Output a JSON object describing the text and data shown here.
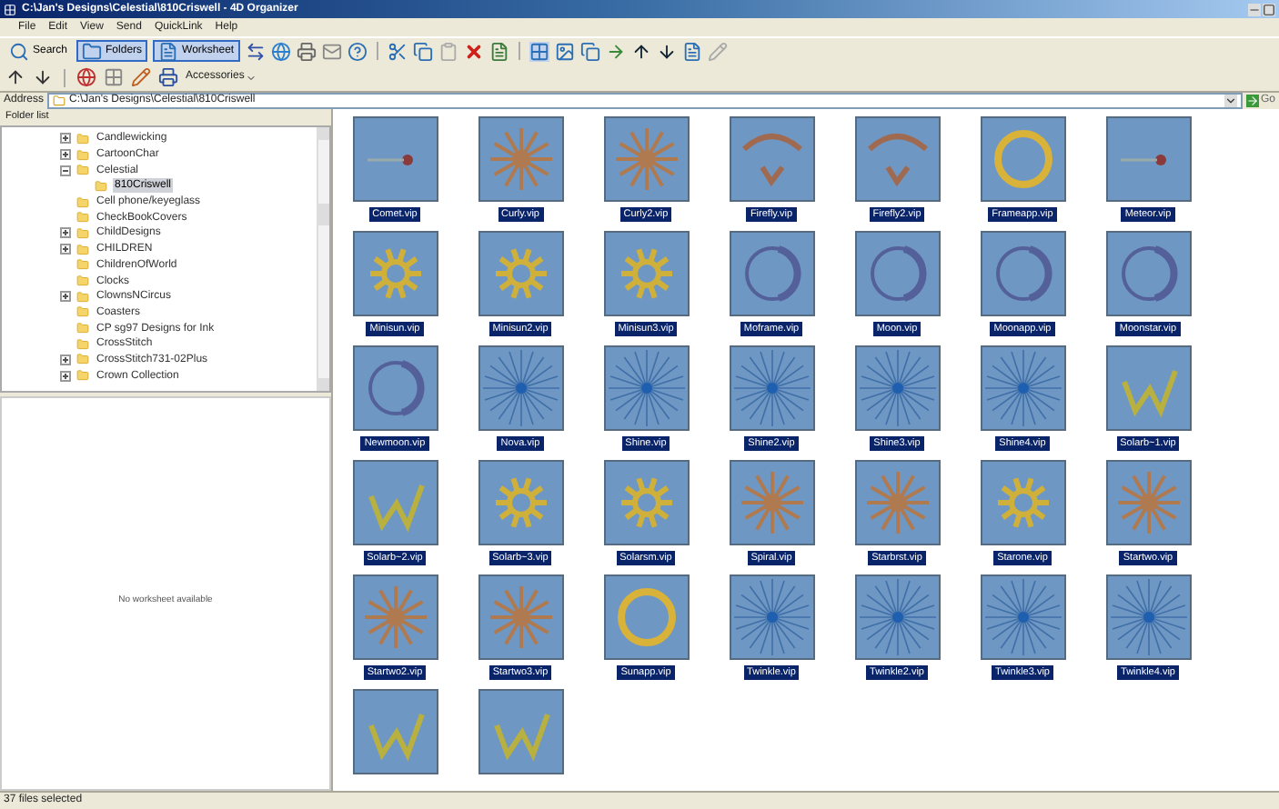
{
  "window": {
    "title": "C:\\Jan's Designs\\Celestial\\810Criswell - 4D Organizer"
  },
  "menu": [
    "File",
    "Edit",
    "View",
    "Send",
    "QuickLink",
    "Help"
  ],
  "toolbar": [
    {
      "label": "Search",
      "selected": false
    },
    {
      "label": "Folders",
      "selected": true
    },
    {
      "label": "Worksheet",
      "selected": true
    }
  ],
  "toolbar2": {
    "accessories": "Accessories"
  },
  "address": {
    "label": "Address",
    "value": "C:\\Jan's Designs\\Celestial\\810Criswell",
    "go": "Go"
  },
  "folder_list": {
    "title": "Folder list",
    "items": [
      {
        "label": "Candlewicking",
        "kind": "collapsed",
        "selected": false
      },
      {
        "label": "CartoonChar",
        "kind": "collapsed",
        "selected": false
      },
      {
        "label": "Celestial",
        "kind": "expanded",
        "selected": false,
        "children": [
          {
            "label": "810Criswell",
            "selected": true
          }
        ]
      },
      {
        "label": "Cell phone/keyeglass",
        "kind": "leaf",
        "selected": false
      },
      {
        "label": "CheckBookCovers",
        "kind": "leaf",
        "selected": false
      },
      {
        "label": "ChildDesigns",
        "kind": "collapsed",
        "selected": false
      },
      {
        "label": "CHILDREN",
        "kind": "collapsed",
        "selected": false
      },
      {
        "label": "ChildrenOfWorld",
        "kind": "leaf",
        "selected": false
      },
      {
        "label": "Clocks",
        "kind": "leaf",
        "selected": false
      },
      {
        "label": "ClownsNCircus",
        "kind": "collapsed",
        "selected": false
      },
      {
        "label": "Coasters",
        "kind": "leaf",
        "selected": false
      },
      {
        "label": "CP sg97 Designs for Ink",
        "kind": "leaf",
        "selected": false
      },
      {
        "label": "CrossStitch",
        "kind": "leaf",
        "selected": false
      },
      {
        "label": "CrossStitch731-02Plus",
        "kind": "collapsed",
        "selected": false
      },
      {
        "label": "Crown Collection",
        "kind": "collapsed",
        "selected": false
      }
    ]
  },
  "preview": {
    "message": "No worksheet available"
  },
  "files": [
    {
      "name": "Comet.vip",
      "kind": "comet",
      "selected": true
    },
    {
      "name": "Curly.vip",
      "kind": "star",
      "selected": true
    },
    {
      "name": "Curly2.vip",
      "kind": "star",
      "selected": true
    },
    {
      "name": "Firefly.vip",
      "kind": "ornament",
      "selected": true
    },
    {
      "name": "Firefly2.vip",
      "kind": "ornament",
      "selected": true
    },
    {
      "name": "Frameapp.vip",
      "kind": "ring",
      "selected": true
    },
    {
      "name": "Meteor.vip",
      "kind": "comet",
      "selected": true
    },
    {
      "name": "Minisun.vip",
      "kind": "sun",
      "selected": true
    },
    {
      "name": "Minisun2.vip",
      "kind": "sun",
      "selected": true
    },
    {
      "name": "Minisun3.vip",
      "kind": "sun",
      "selected": true
    },
    {
      "name": "Moframe.vip",
      "kind": "crescent",
      "selected": true
    },
    {
      "name": "Moon.vip",
      "kind": "crescent",
      "selected": true
    },
    {
      "name": "Moonapp.vip",
      "kind": "crescent",
      "selected": true
    },
    {
      "name": "Moonstar.vip",
      "kind": "crescent",
      "selected": true
    },
    {
      "name": "Newmoon.vip",
      "kind": "crescent",
      "selected": true
    },
    {
      "name": "Nova.vip",
      "kind": "rays",
      "selected": true
    },
    {
      "name": "Shine.vip",
      "kind": "rays",
      "selected": true
    },
    {
      "name": "Shine2.vip",
      "kind": "rays",
      "selected": true
    },
    {
      "name": "Shine3.vip",
      "kind": "rays",
      "selected": true
    },
    {
      "name": "Shine4.vip",
      "kind": "rays",
      "selected": true
    },
    {
      "name": "Solarb~1.vip",
      "kind": "leaf",
      "selected": true
    },
    {
      "name": "Solarb~2.vip",
      "kind": "leaf",
      "selected": true
    },
    {
      "name": "Solarb~3.vip",
      "kind": "sun",
      "selected": true
    },
    {
      "name": "Solarsm.vip",
      "kind": "sun",
      "selected": true
    },
    {
      "name": "Spiral.vip",
      "kind": "star",
      "selected": true
    },
    {
      "name": "Starbrst.vip",
      "kind": "star",
      "selected": true
    },
    {
      "name": "Starone.vip",
      "kind": "sun",
      "selected": true
    },
    {
      "name": "Startwo.vip",
      "kind": "star",
      "selected": true
    },
    {
      "name": "Startwo2.vip",
      "kind": "star",
      "selected": true
    },
    {
      "name": "Startwo3.vip",
      "kind": "star",
      "selected": true
    },
    {
      "name": "Sunapp.vip",
      "kind": "ring",
      "selected": true
    },
    {
      "name": "Twinkle.vip",
      "kind": "rays",
      "selected": true
    },
    {
      "name": "Twinkle2.vip",
      "kind": "rays",
      "selected": true
    },
    {
      "name": "Twinkle3.vip",
      "kind": "rays",
      "selected": true
    },
    {
      "name": "Twinkle4.vip",
      "kind": "rays",
      "selected": true
    },
    {
      "kind": "leaf"
    },
    {
      "kind": "leaf"
    }
  ],
  "status_bar": "37 files selected"
}
